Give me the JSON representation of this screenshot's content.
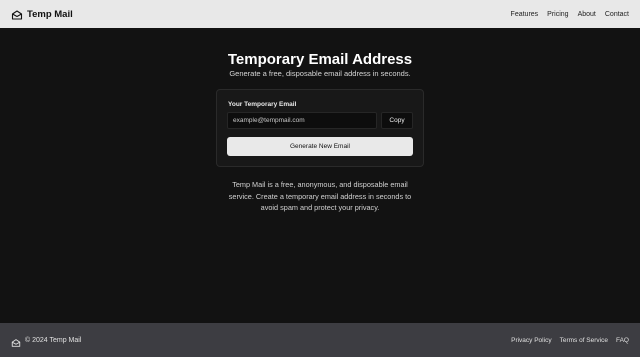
{
  "header": {
    "brand": "Temp Mail",
    "nav": [
      "Features",
      "Pricing",
      "About",
      "Contact"
    ]
  },
  "hero": {
    "title": "Temporary Email Address",
    "subtitle": "Generate a free, disposable email address in seconds."
  },
  "card": {
    "label": "Your Temporary Email",
    "email_value": "",
    "email_placeholder": "example@tempmail.com",
    "copy_label": "Copy",
    "generate_label": "Generate New Email"
  },
  "description": "Temp Mail is a free, anonymous, and disposable email service. Create a temporary email address in seconds to avoid spam and protect your privacy.",
  "footer": {
    "copyright": "© 2024 Temp Mail",
    "links": [
      "Privacy Policy",
      "Terms of Service",
      "FAQ"
    ]
  },
  "colors": {
    "background": "#121212",
    "header_bg": "#e8e8e8",
    "footer_bg": "#3d3d42",
    "primary_button": "#e9e9e9"
  },
  "icons": {
    "brand": "mail-open-icon",
    "footer": "mail-open-icon"
  }
}
